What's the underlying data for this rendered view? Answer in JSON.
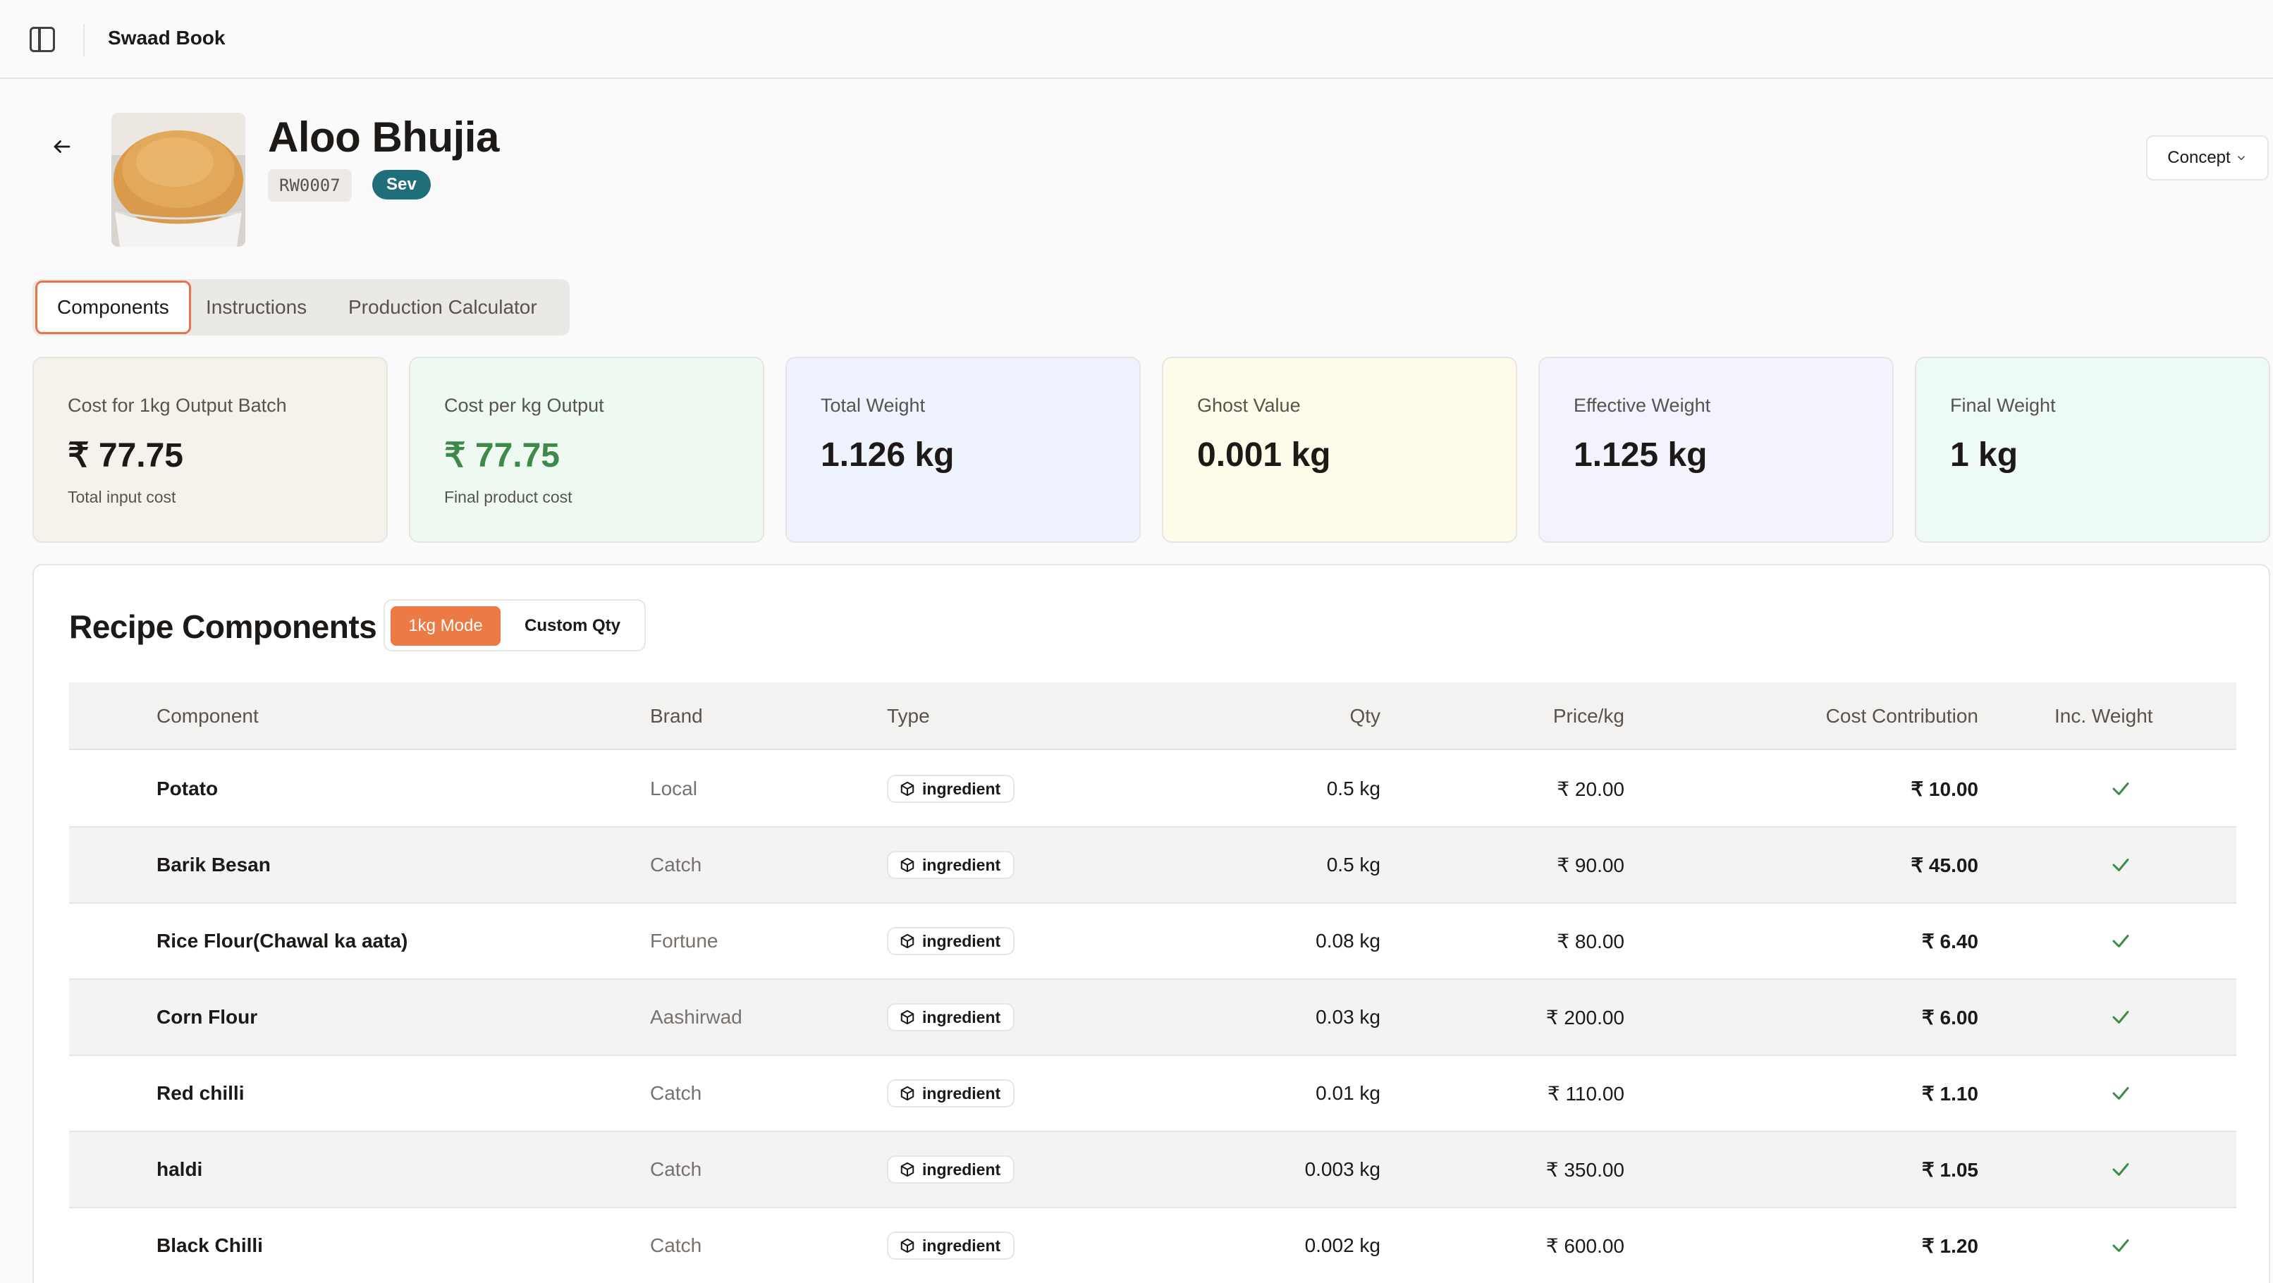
{
  "app": {
    "title": "Swaad Book"
  },
  "product": {
    "name": "Aloo Bhujia",
    "code": "RW0007",
    "category": "Sev",
    "status": "Concept"
  },
  "tabs": [
    {
      "label": "Components",
      "active": true
    },
    {
      "label": "Instructions",
      "active": false
    },
    {
      "label": "Production Calculator",
      "active": false
    }
  ],
  "stats": [
    {
      "label": "Cost for 1kg Output Batch",
      "value": "₹ 77.75",
      "sub": "Total input cost",
      "bg": "#f7f1ec",
      "valueColor": "#1c1917"
    },
    {
      "label": "Cost per kg Output",
      "value": "₹ 77.75",
      "sub": "Final product cost",
      "bg": "#eefaf1",
      "valueColor": "#3f8a4a"
    },
    {
      "label": "Total Weight",
      "value": "1.126 kg",
      "sub": "",
      "bg": "#eef3fd",
      "valueColor": "#1c1917"
    },
    {
      "label": "Ghost Value",
      "value": "0.001 kg",
      "sub": "",
      "bg": "#fefbea",
      "valueColor": "#1c1917"
    },
    {
      "label": "Effective Weight",
      "value": "1.125 kg",
      "sub": "",
      "bg": "#f4f2fd",
      "valueColor": "#1c1917"
    },
    {
      "label": "Final Weight",
      "value": "1 kg",
      "sub": "",
      "bg": "#eefaf5",
      "valueColor": "#1c1917"
    }
  ],
  "components": {
    "title": "Recipe Components",
    "modes": {
      "active": "1kg Mode",
      "inactive": "Custom Qty"
    },
    "headers": {
      "component": "Component",
      "brand": "Brand",
      "type": "Type",
      "qty": "Qty",
      "price": "Price/kg",
      "cost": "Cost Contribution",
      "inc_weight": "Inc. Weight"
    },
    "rows": [
      {
        "name": "Potato",
        "brand": "Local",
        "type": "ingredient",
        "qty": "0.5 kg",
        "price": "₹ 20.00",
        "cost": "₹ 10.00",
        "inc": true
      },
      {
        "name": "Barik Besan",
        "brand": "Catch",
        "type": "ingredient",
        "qty": "0.5 kg",
        "price": "₹ 90.00",
        "cost": "₹ 45.00",
        "inc": true
      },
      {
        "name": "Rice Flour(Chawal ka aata)",
        "brand": "Fortune",
        "type": "ingredient",
        "qty": "0.08 kg",
        "price": "₹ 80.00",
        "cost": "₹ 6.40",
        "inc": true
      },
      {
        "name": "Corn Flour",
        "brand": "Aashirwad",
        "type": "ingredient",
        "qty": "0.03 kg",
        "price": "₹ 200.00",
        "cost": "₹ 6.00",
        "inc": true
      },
      {
        "name": "Red chilli",
        "brand": "Catch",
        "type": "ingredient",
        "qty": "0.01 kg",
        "price": "₹ 110.00",
        "cost": "₹ 1.10",
        "inc": true
      },
      {
        "name": "haldi",
        "brand": "Catch",
        "type": "ingredient",
        "qty": "0.003 kg",
        "price": "₹ 350.00",
        "cost": "₹ 1.05",
        "inc": true
      },
      {
        "name": "Black Chilli",
        "brand": "Catch",
        "type": "ingredient",
        "qty": "0.002 kg",
        "price": "₹ 600.00",
        "cost": "₹ 1.20",
        "inc": true
      }
    ]
  },
  "colors": {
    "accent": "#ec7a45",
    "check": "#3f8a4a",
    "badge": "#1f6f7a"
  }
}
